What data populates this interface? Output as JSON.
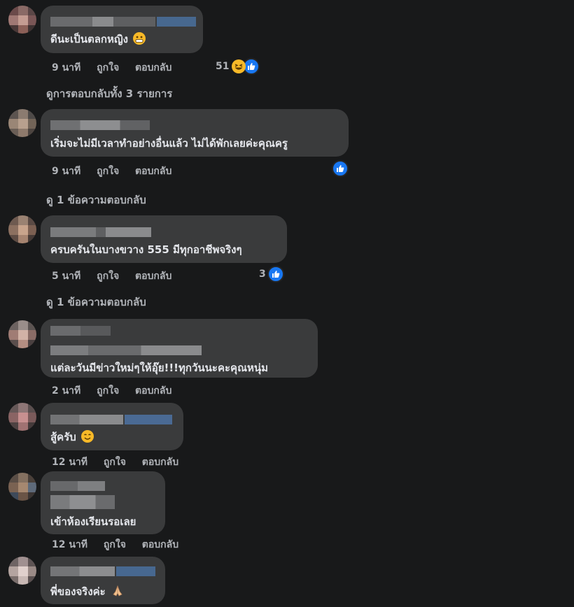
{
  "comments": [
    {
      "text": "ดีนะเป็นตลกหญิง",
      "emoji": "grimacing-face-icon",
      "time": "9 นาที",
      "like": "ถูกใจ",
      "reply": "ตอบกลับ",
      "reactions": "51",
      "view_replies": "ดูการตอบกลับทั้ง 3 รายการ"
    },
    {
      "text": "เริ่มจะไม่มีเวลาทำอย่างอื่นแล้ว ไม่ได้พักเลยค่ะคุณครู",
      "time": "9 นาที",
      "like": "ถูกใจ",
      "reply": "ตอบกลับ",
      "reactions": "",
      "view_replies": "ดู 1 ข้อความตอบกลับ"
    },
    {
      "text": "ครบครันในบางขวาง 555 มีทุกอาชีพจริงๆ",
      "time": "5 นาที",
      "like": "ถูกใจ",
      "reply": "ตอบกลับ",
      "reactions": "3",
      "view_replies": "ดู 1 ข้อความตอบกลับ"
    },
    {
      "text": "แต่ละวันมีข่าวใหม่ๆให้อุ๊ย!!!ทุกวันนะคะคุณหนุ่ม",
      "time": "2 นาที",
      "like": "ถูกใจ",
      "reply": "ตอบกลับ"
    },
    {
      "text": "สู้ครับ",
      "emoji": "smiling-face-icon",
      "time": "12 นาที",
      "like": "ถูกใจ",
      "reply": "ตอบกลับ"
    },
    {
      "text": "เข้าห้องเรียนรอเลย",
      "time": "12 นาที",
      "like": "ถูกใจ",
      "reply": "ตอบกลับ"
    },
    {
      "text": "พี่ของจริงค่ะ",
      "emoji": "folded-hands-icon"
    }
  ],
  "colors": {
    "background": "#18191a",
    "bubble": "#3a3b3c",
    "meta_text": "#b0b3b8",
    "like_blue": "#1877f2",
    "haha_yellow": "#f7b928"
  }
}
